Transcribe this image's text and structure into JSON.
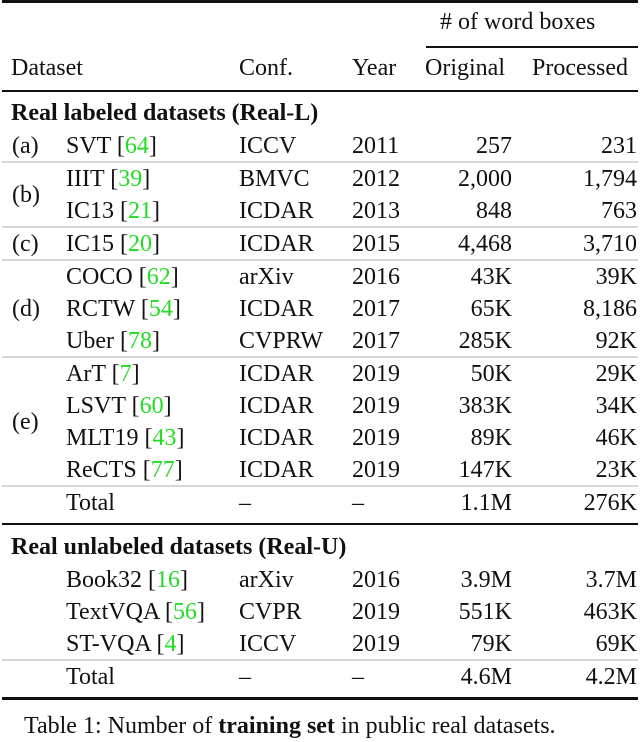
{
  "table": {
    "header": {
      "span_label": "# of word boxes",
      "columns": [
        "Dataset",
        "Conf.",
        "Year",
        "Original",
        "Processed"
      ]
    },
    "sections": [
      {
        "title": "Real labeled datasets (Real-L)",
        "groups": [
          {
            "label": "(a)",
            "rows": [
              {
                "name": "SVT",
                "ref": "64",
                "conf": "ICCV",
                "year": "2011",
                "original": "257",
                "processed": "231"
              }
            ]
          },
          {
            "label": "(b)",
            "rows": [
              {
                "name": "IIIT",
                "ref": "39",
                "conf": "BMVC",
                "year": "2012",
                "original": "2,000",
                "processed": "1,794"
              },
              {
                "name": "IC13",
                "ref": "21",
                "conf": "ICDAR",
                "year": "2013",
                "original": "848",
                "processed": "763"
              }
            ]
          },
          {
            "label": "(c)",
            "rows": [
              {
                "name": "IC15",
                "ref": "20",
                "conf": "ICDAR",
                "year": "2015",
                "original": "4,468",
                "processed": "3,710"
              }
            ]
          },
          {
            "label": "(d)",
            "rows": [
              {
                "name": "COCO",
                "ref": "62",
                "conf": "arXiv",
                "year": "2016",
                "original": "43K",
                "processed": "39K"
              },
              {
                "name": "RCTW",
                "ref": "54",
                "conf": "ICDAR",
                "year": "2017",
                "original": "65K",
                "processed": "8,186"
              },
              {
                "name": "Uber",
                "ref": "78",
                "conf": "CVPRW",
                "year": "2017",
                "original": "285K",
                "processed": "92K"
              }
            ]
          },
          {
            "label": "(e)",
            "rows": [
              {
                "name": "ArT",
                "ref": "7",
                "conf": "ICDAR",
                "year": "2019",
                "original": "50K",
                "processed": "29K"
              },
              {
                "name": "LSVT",
                "ref": "60",
                "conf": "ICDAR",
                "year": "2019",
                "original": "383K",
                "processed": "34K"
              },
              {
                "name": "MLT19",
                "ref": "43",
                "conf": "ICDAR",
                "year": "2019",
                "original": "89K",
                "processed": "46K"
              },
              {
                "name": "ReCTS",
                "ref": "77",
                "conf": "ICDAR",
                "year": "2019",
                "original": "147K",
                "processed": "23K"
              }
            ]
          }
        ],
        "total": {
          "name": "Total",
          "conf": "–",
          "year": "–",
          "original": "1.1M",
          "processed": "276K"
        }
      },
      {
        "title": "Real unlabeled datasets (Real-U)",
        "groups": [
          {
            "label": "",
            "rows": [
              {
                "name": "Book32",
                "ref": "16",
                "conf": "arXiv",
                "year": "2016",
                "original": "3.9M",
                "processed": "3.7M"
              },
              {
                "name": "TextVQA",
                "ref": "56",
                "conf": "CVPR",
                "year": "2019",
                "original": "551K",
                "processed": "463K"
              },
              {
                "name": "ST-VQA",
                "ref": "4",
                "conf": "ICCV",
                "year": "2019",
                "original": "79K",
                "processed": "69K"
              }
            ]
          }
        ],
        "total": {
          "name": "Total",
          "conf": "–",
          "year": "–",
          "original": "4.6M",
          "processed": "4.2M"
        }
      }
    ]
  },
  "caption": {
    "prefix": "Table 1: Number of ",
    "bold": "training set",
    "suffix": " in public real datasets."
  },
  "colors": {
    "reference_link": "#22dd22",
    "text": "#111111",
    "light_rule": "#d6d6d6"
  }
}
